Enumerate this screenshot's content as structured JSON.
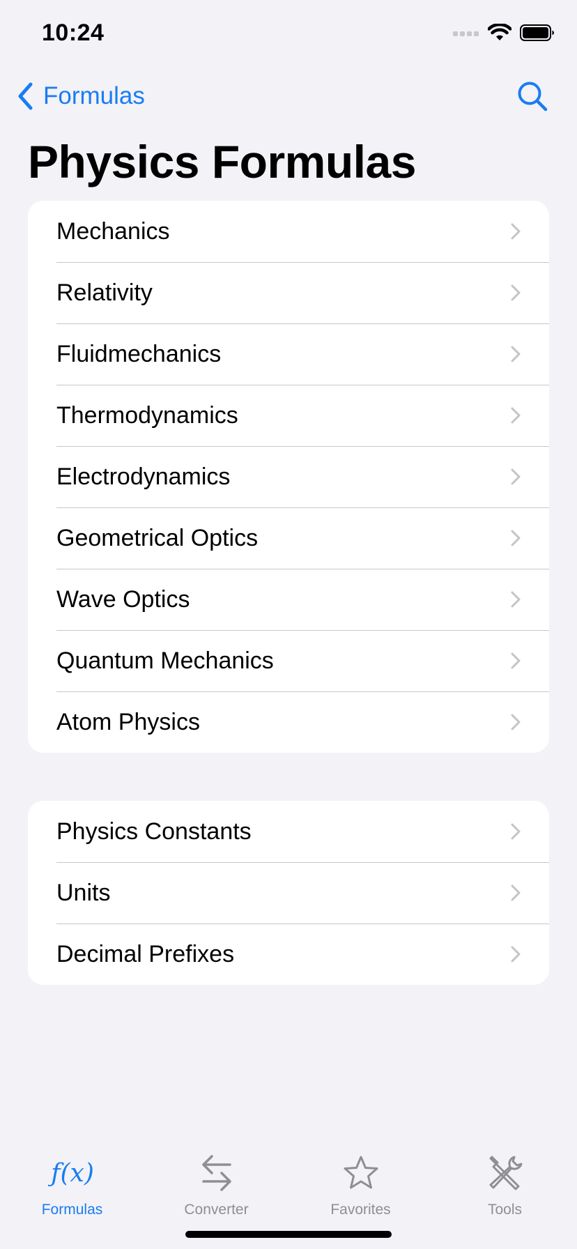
{
  "status_bar": {
    "time": "10:24"
  },
  "nav": {
    "back_label": "Formulas",
    "title": "Physics Formulas"
  },
  "colors": {
    "accent": "#1A7CF2",
    "background": "#F2F2F7",
    "card": "#FFFFFF",
    "separator": "#C6C6C8",
    "chevron": "#C4C4C7",
    "inactive_tab": "#8E8E93"
  },
  "topics": [
    {
      "label": "Mechanics"
    },
    {
      "label": "Relativity"
    },
    {
      "label": "Fluidmechanics"
    },
    {
      "label": "Thermodynamics"
    },
    {
      "label": "Electrodynamics"
    },
    {
      "label": "Geometrical Optics"
    },
    {
      "label": "Wave Optics"
    },
    {
      "label": "Quantum Mechanics"
    },
    {
      "label": "Atom Physics"
    }
  ],
  "references": [
    {
      "label": "Physics Constants"
    },
    {
      "label": "Units"
    },
    {
      "label": "Decimal Prefixes"
    }
  ],
  "tabs": [
    {
      "label": "Formulas",
      "icon": "function-icon",
      "active": true
    },
    {
      "label": "Converter",
      "icon": "arrows-exchange-icon",
      "active": false
    },
    {
      "label": "Favorites",
      "icon": "star-icon",
      "active": false
    },
    {
      "label": "Tools",
      "icon": "tools-icon",
      "active": false
    }
  ]
}
